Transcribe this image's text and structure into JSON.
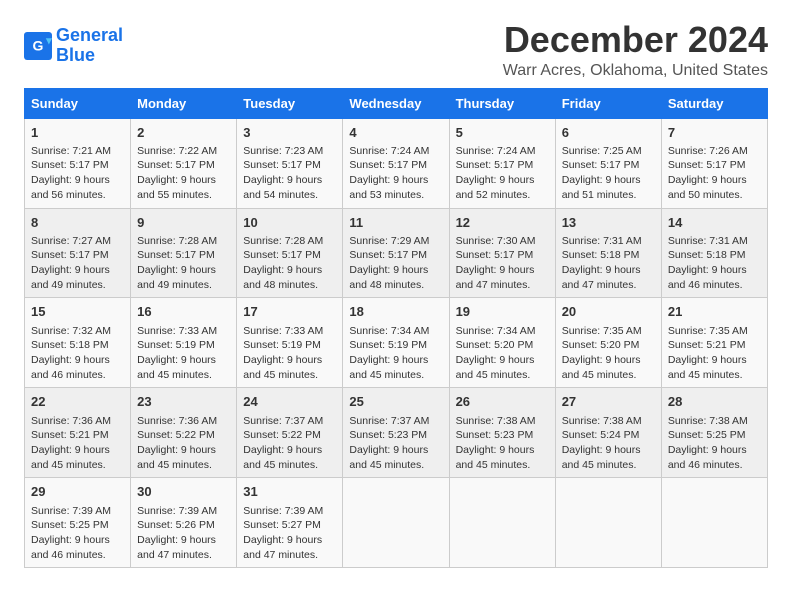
{
  "header": {
    "logo_line1": "General",
    "logo_line2": "Blue",
    "title": "December 2024",
    "subtitle": "Warr Acres, Oklahoma, United States"
  },
  "weekdays": [
    "Sunday",
    "Monday",
    "Tuesday",
    "Wednesday",
    "Thursday",
    "Friday",
    "Saturday"
  ],
  "weeks": [
    [
      {
        "day": "1",
        "info": "Sunrise: 7:21 AM\nSunset: 5:17 PM\nDaylight: 9 hours\nand 56 minutes."
      },
      {
        "day": "2",
        "info": "Sunrise: 7:22 AM\nSunset: 5:17 PM\nDaylight: 9 hours\nand 55 minutes."
      },
      {
        "day": "3",
        "info": "Sunrise: 7:23 AM\nSunset: 5:17 PM\nDaylight: 9 hours\nand 54 minutes."
      },
      {
        "day": "4",
        "info": "Sunrise: 7:24 AM\nSunset: 5:17 PM\nDaylight: 9 hours\nand 53 minutes."
      },
      {
        "day": "5",
        "info": "Sunrise: 7:24 AM\nSunset: 5:17 PM\nDaylight: 9 hours\nand 52 minutes."
      },
      {
        "day": "6",
        "info": "Sunrise: 7:25 AM\nSunset: 5:17 PM\nDaylight: 9 hours\nand 51 minutes."
      },
      {
        "day": "7",
        "info": "Sunrise: 7:26 AM\nSunset: 5:17 PM\nDaylight: 9 hours\nand 50 minutes."
      }
    ],
    [
      {
        "day": "8",
        "info": "Sunrise: 7:27 AM\nSunset: 5:17 PM\nDaylight: 9 hours\nand 49 minutes."
      },
      {
        "day": "9",
        "info": "Sunrise: 7:28 AM\nSunset: 5:17 PM\nDaylight: 9 hours\nand 49 minutes."
      },
      {
        "day": "10",
        "info": "Sunrise: 7:28 AM\nSunset: 5:17 PM\nDaylight: 9 hours\nand 48 minutes."
      },
      {
        "day": "11",
        "info": "Sunrise: 7:29 AM\nSunset: 5:17 PM\nDaylight: 9 hours\nand 48 minutes."
      },
      {
        "day": "12",
        "info": "Sunrise: 7:30 AM\nSunset: 5:17 PM\nDaylight: 9 hours\nand 47 minutes."
      },
      {
        "day": "13",
        "info": "Sunrise: 7:31 AM\nSunset: 5:18 PM\nDaylight: 9 hours\nand 47 minutes."
      },
      {
        "day": "14",
        "info": "Sunrise: 7:31 AM\nSunset: 5:18 PM\nDaylight: 9 hours\nand 46 minutes."
      }
    ],
    [
      {
        "day": "15",
        "info": "Sunrise: 7:32 AM\nSunset: 5:18 PM\nDaylight: 9 hours\nand 46 minutes."
      },
      {
        "day": "16",
        "info": "Sunrise: 7:33 AM\nSunset: 5:19 PM\nDaylight: 9 hours\nand 45 minutes."
      },
      {
        "day": "17",
        "info": "Sunrise: 7:33 AM\nSunset: 5:19 PM\nDaylight: 9 hours\nand 45 minutes."
      },
      {
        "day": "18",
        "info": "Sunrise: 7:34 AM\nSunset: 5:19 PM\nDaylight: 9 hours\nand 45 minutes."
      },
      {
        "day": "19",
        "info": "Sunrise: 7:34 AM\nSunset: 5:20 PM\nDaylight: 9 hours\nand 45 minutes."
      },
      {
        "day": "20",
        "info": "Sunrise: 7:35 AM\nSunset: 5:20 PM\nDaylight: 9 hours\nand 45 minutes."
      },
      {
        "day": "21",
        "info": "Sunrise: 7:35 AM\nSunset: 5:21 PM\nDaylight: 9 hours\nand 45 minutes."
      }
    ],
    [
      {
        "day": "22",
        "info": "Sunrise: 7:36 AM\nSunset: 5:21 PM\nDaylight: 9 hours\nand 45 minutes."
      },
      {
        "day": "23",
        "info": "Sunrise: 7:36 AM\nSunset: 5:22 PM\nDaylight: 9 hours\nand 45 minutes."
      },
      {
        "day": "24",
        "info": "Sunrise: 7:37 AM\nSunset: 5:22 PM\nDaylight: 9 hours\nand 45 minutes."
      },
      {
        "day": "25",
        "info": "Sunrise: 7:37 AM\nSunset: 5:23 PM\nDaylight: 9 hours\nand 45 minutes."
      },
      {
        "day": "26",
        "info": "Sunrise: 7:38 AM\nSunset: 5:23 PM\nDaylight: 9 hours\nand 45 minutes."
      },
      {
        "day": "27",
        "info": "Sunrise: 7:38 AM\nSunset: 5:24 PM\nDaylight: 9 hours\nand 45 minutes."
      },
      {
        "day": "28",
        "info": "Sunrise: 7:38 AM\nSunset: 5:25 PM\nDaylight: 9 hours\nand 46 minutes."
      }
    ],
    [
      {
        "day": "29",
        "info": "Sunrise: 7:39 AM\nSunset: 5:25 PM\nDaylight: 9 hours\nand 46 minutes."
      },
      {
        "day": "30",
        "info": "Sunrise: 7:39 AM\nSunset: 5:26 PM\nDaylight: 9 hours\nand 47 minutes."
      },
      {
        "day": "31",
        "info": "Sunrise: 7:39 AM\nSunset: 5:27 PM\nDaylight: 9 hours\nand 47 minutes."
      },
      {
        "day": "",
        "info": ""
      },
      {
        "day": "",
        "info": ""
      },
      {
        "day": "",
        "info": ""
      },
      {
        "day": "",
        "info": ""
      }
    ]
  ]
}
